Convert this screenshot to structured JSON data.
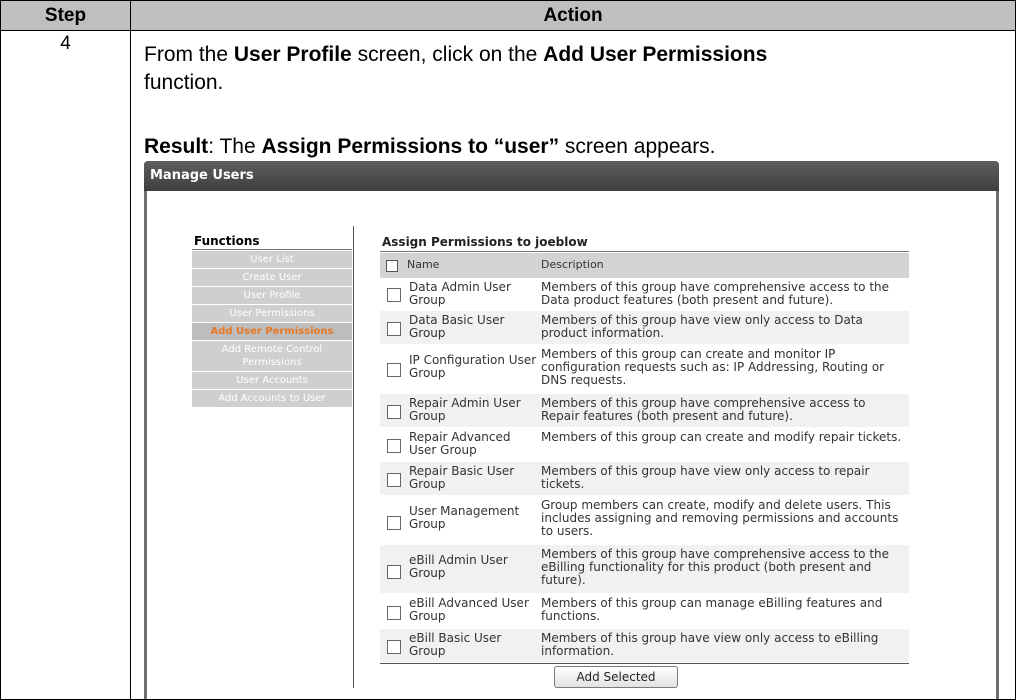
{
  "table": {
    "header_step": "Step",
    "header_action": "Action",
    "step_number": "4"
  },
  "instruction": {
    "p1": "From the ",
    "b1": "User Profile",
    "p2": " screen, click on the ",
    "b2": "Add User Permissions",
    "p3": " function."
  },
  "result": {
    "label": "Result",
    "p1": ":  The ",
    "b1": "Assign Permissions to “user”",
    "p2": " screen appears."
  },
  "screenshot": {
    "window_title": "Manage Users",
    "functions_title": "Functions",
    "functions": [
      "User List",
      "Create User",
      "User Profile",
      "User Permissions",
      "Add User Permissions",
      "Add Remote Control Permissions",
      "User Accounts",
      "Add Accounts to User"
    ],
    "panel_title": "Assign Permissions to joeblow",
    "col_name": "Name",
    "col_description": "Description",
    "groups": [
      {
        "name": "Data Admin User Group",
        "description": "Members of this group have comprehensive access to the Data product features (both present and future)."
      },
      {
        "name": "Data Basic User Group",
        "description": "Members of this group have view only access to Data product information."
      },
      {
        "name": "IP Configuration User Group",
        "description": "Members of this group can create and monitor IP configuration requests such as: IP Addressing, Routing or DNS requests."
      },
      {
        "name": "Repair Admin User Group",
        "description": "Members of this group have comprehensive access to Repair features (both present and future)."
      },
      {
        "name": "Repair Advanced User Group",
        "description": "Members of this group can create and modify repair tickets."
      },
      {
        "name": "Repair Basic User Group",
        "description": "Members of this group have view only access to repair tickets."
      },
      {
        "name": "User Management Group",
        "description": "Group members can create, modify and delete users. This includes assigning and removing permissions and accounts to users."
      },
      {
        "name": "eBill Admin User Group",
        "description": "Members of this group have comprehensive access to the eBilling functionality for this product (both present and future)."
      },
      {
        "name": "eBill Advanced User Group",
        "description": "Members of this group can manage eBilling features and functions."
      },
      {
        "name": "eBill Basic User Group",
        "description": "Members of this group have view only access to eBilling information."
      }
    ],
    "add_button": "Add Selected"
  }
}
